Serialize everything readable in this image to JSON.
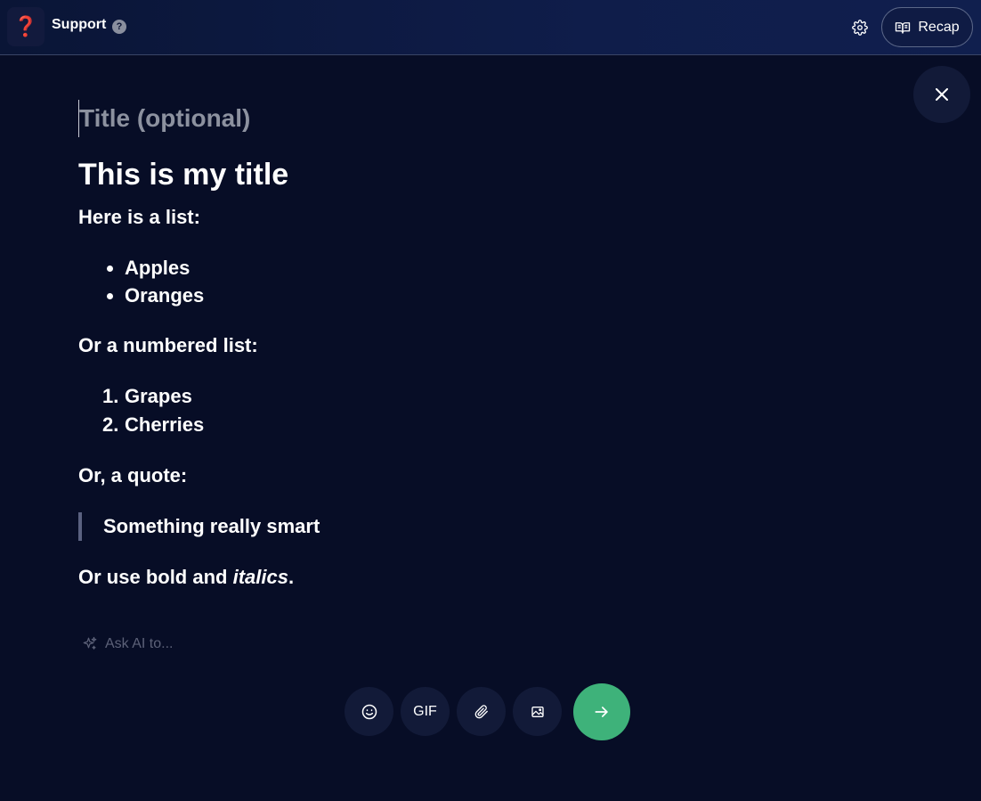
{
  "header": {
    "channel_icon_glyph": "❓",
    "channel_name": "Support",
    "help_glyph": "?",
    "settings_icon": "gear-icon",
    "recap_label": "Recap"
  },
  "editor": {
    "title_placeholder": "Title (optional)",
    "title_value": "",
    "heading": "This is my title",
    "list_intro": "Here is a list:",
    "bullets": [
      "Apples",
      "Oranges"
    ],
    "numbered_intro": "Or a numbered list:",
    "numbered": [
      {
        "num": "1.",
        "text": "Grapes"
      },
      {
        "num": "2.",
        "text": "Cherries"
      }
    ],
    "quote_intro": "Or, a quote:",
    "quote": "Something really smart",
    "format_line": {
      "prefix": "Or use ",
      "bold": "bold",
      "middle": " and ",
      "italic": "italics",
      "suffix": "."
    }
  },
  "ai_prompt": {
    "placeholder": "Ask AI to..."
  },
  "toolbar": {
    "emoji_icon": "smiley-icon",
    "gif_label": "GIF",
    "attach_icon": "paperclip-icon",
    "image_icon": "image-icon",
    "send_icon": "arrow-right-icon"
  },
  "colors": {
    "background": "#070d26",
    "send_button": "#3eb27a",
    "channel_icon": "#e0242f"
  }
}
